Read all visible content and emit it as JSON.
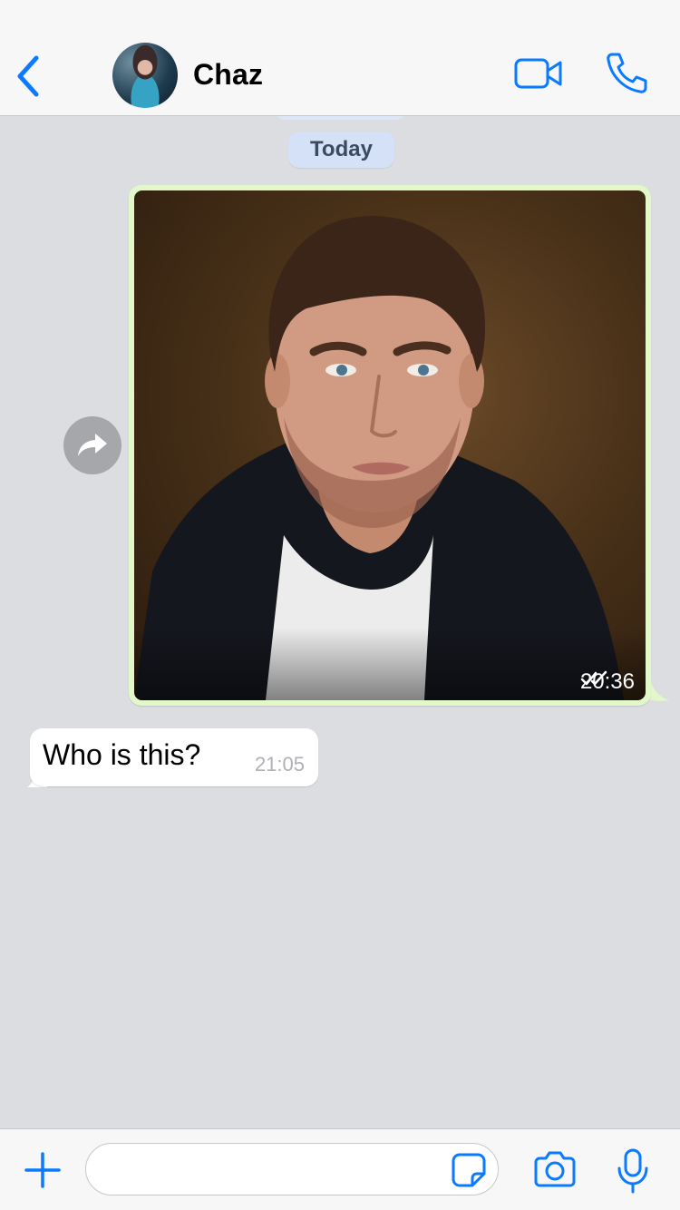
{
  "header": {
    "contact_name": "Chaz",
    "back_icon": "chevron-left-icon",
    "video_icon": "video-camera-icon",
    "call_icon": "phone-icon"
  },
  "chat": {
    "date_label": "Today",
    "messages": [
      {
        "direction": "outgoing",
        "type": "image",
        "time": "20:36",
        "status": "read",
        "status_icon": "double-check-icon"
      },
      {
        "direction": "incoming",
        "type": "text",
        "text": "Who is this?",
        "time": "21:05"
      }
    ]
  },
  "composer": {
    "input_value": "",
    "plus_icon": "plus-icon",
    "sticker_icon": "sticker-icon",
    "camera_icon": "camera-icon",
    "mic_icon": "microphone-icon"
  },
  "colors": {
    "accent": "#0a7aff",
    "outgoing_bubble": "#e2f8c9",
    "incoming_bubble": "#ffffff",
    "chat_background": "#dcdde1",
    "date_pill": "#d5e1f6"
  }
}
